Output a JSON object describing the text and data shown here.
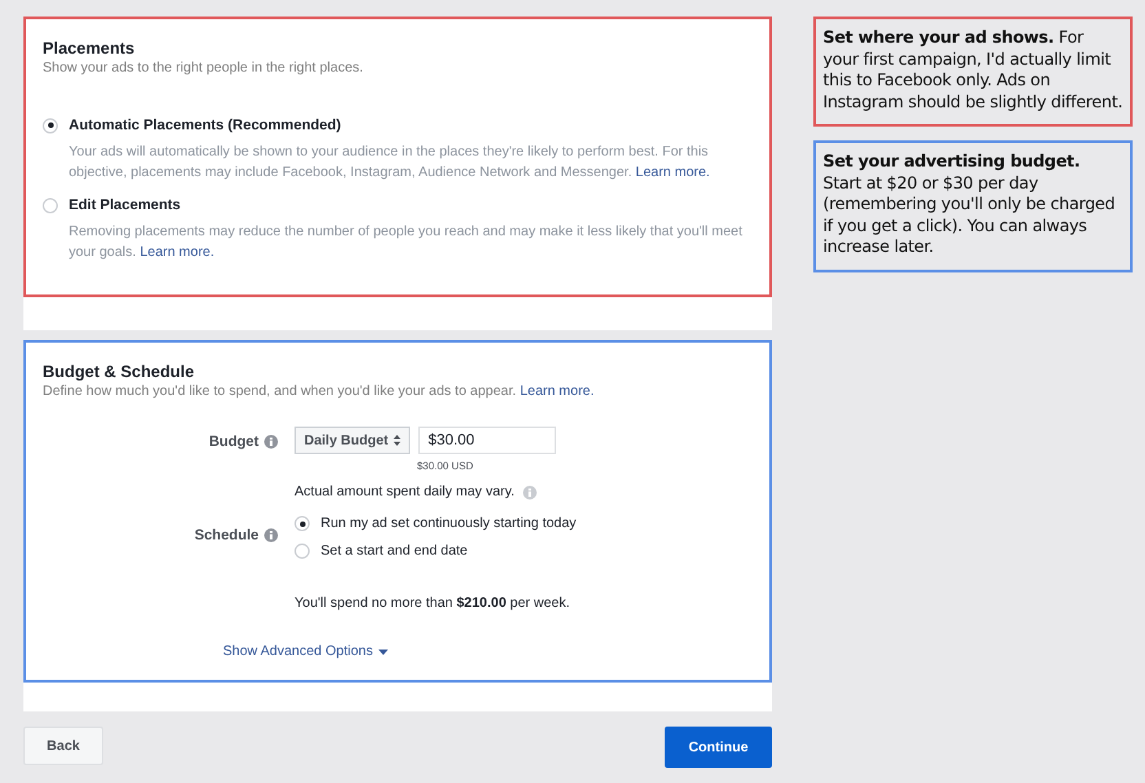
{
  "placements": {
    "title": "Placements",
    "subtitle": "Show your ads to the right people in the right places.",
    "options": [
      {
        "label": "Automatic Placements (Recommended)",
        "selected": true,
        "description": "Your ads will automatically be shown to your audience in the places they're likely to perform best. For this objective, placements may include Facebook, Instagram, Audience Network and Messenger.",
        "link": "Learn more."
      },
      {
        "label": "Edit Placements",
        "selected": false,
        "description": "Removing placements may reduce the number of people you reach and may make it less likely that you'll meet your goals.",
        "link": "Learn more."
      }
    ]
  },
  "budget_schedule": {
    "title": "Budget & Schedule",
    "subtitle": "Define how much you'd like to spend, and when you'd like your ads to appear.",
    "subtitle_link": "Learn more.",
    "budget_label": "Budget",
    "budget_type": "Daily Budget",
    "budget_value": "$30.00",
    "budget_currency": "$30.00 USD",
    "budget_note": "Actual amount spent daily may vary.",
    "schedule_label": "Schedule",
    "schedule_options": [
      {
        "label": "Run my ad set continuously starting today",
        "selected": true
      },
      {
        "label": "Set a start and end date",
        "selected": false
      }
    ],
    "weekly_note": "You'll spend no more than **$210.00** per week.",
    "advanced_link": "Show Advanced Options"
  },
  "buttons": {
    "back": "Back",
    "continue": "Continue"
  },
  "notes": [
    {
      "text": "**Set where your ad shows.** For your first campaign, I'd actually limit this to Facebook only. Ads on Instagram should be slightly different.",
      "color": "#e0585a"
    },
    {
      "text": "**Set your advertising budget.** Start at $20 or $30 per day (remembering you'll only be charged if you get a click). You can always increase later.",
      "color": "#5b8fe6"
    }
  ]
}
